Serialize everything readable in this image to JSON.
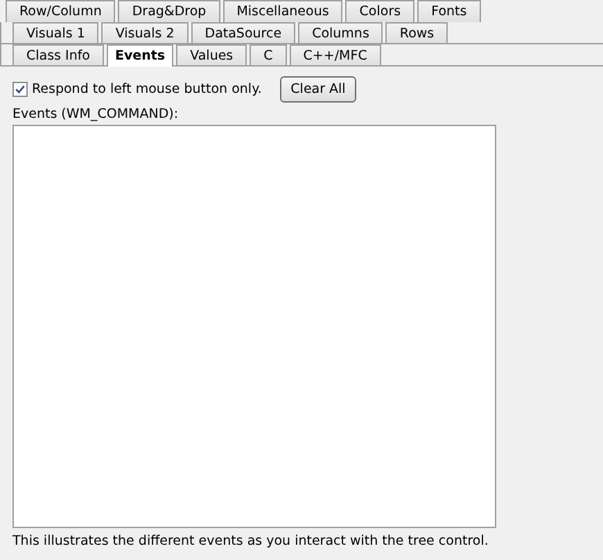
{
  "tab_rows": [
    {
      "tabs": [
        {
          "label": "Row/Column",
          "selected": false
        },
        {
          "label": "Drag&Drop",
          "selected": false
        },
        {
          "label": "Miscellaneous",
          "selected": false
        },
        {
          "label": "Colors",
          "selected": false
        },
        {
          "label": "Fonts",
          "selected": false
        }
      ]
    },
    {
      "tabs": [
        {
          "label": "Visuals 1",
          "selected": false
        },
        {
          "label": "Visuals 2",
          "selected": false
        },
        {
          "label": "DataSource",
          "selected": false
        },
        {
          "label": "Columns",
          "selected": false
        },
        {
          "label": "Rows",
          "selected": false
        }
      ]
    },
    {
      "tabs": [
        {
          "label": "Class Info",
          "selected": false
        },
        {
          "label": "Events",
          "selected": true
        },
        {
          "label": "Values",
          "selected": false
        },
        {
          "label": "C",
          "selected": false
        },
        {
          "label": "C++/MFC",
          "selected": false
        }
      ]
    }
  ],
  "respond_checkbox": {
    "label": "Respond to left mouse button only.",
    "checked": true
  },
  "clear_button": "Clear All",
  "events_label": "Events (WM_COMMAND):",
  "footer": "This illustrates the different events as you interact with the tree control."
}
